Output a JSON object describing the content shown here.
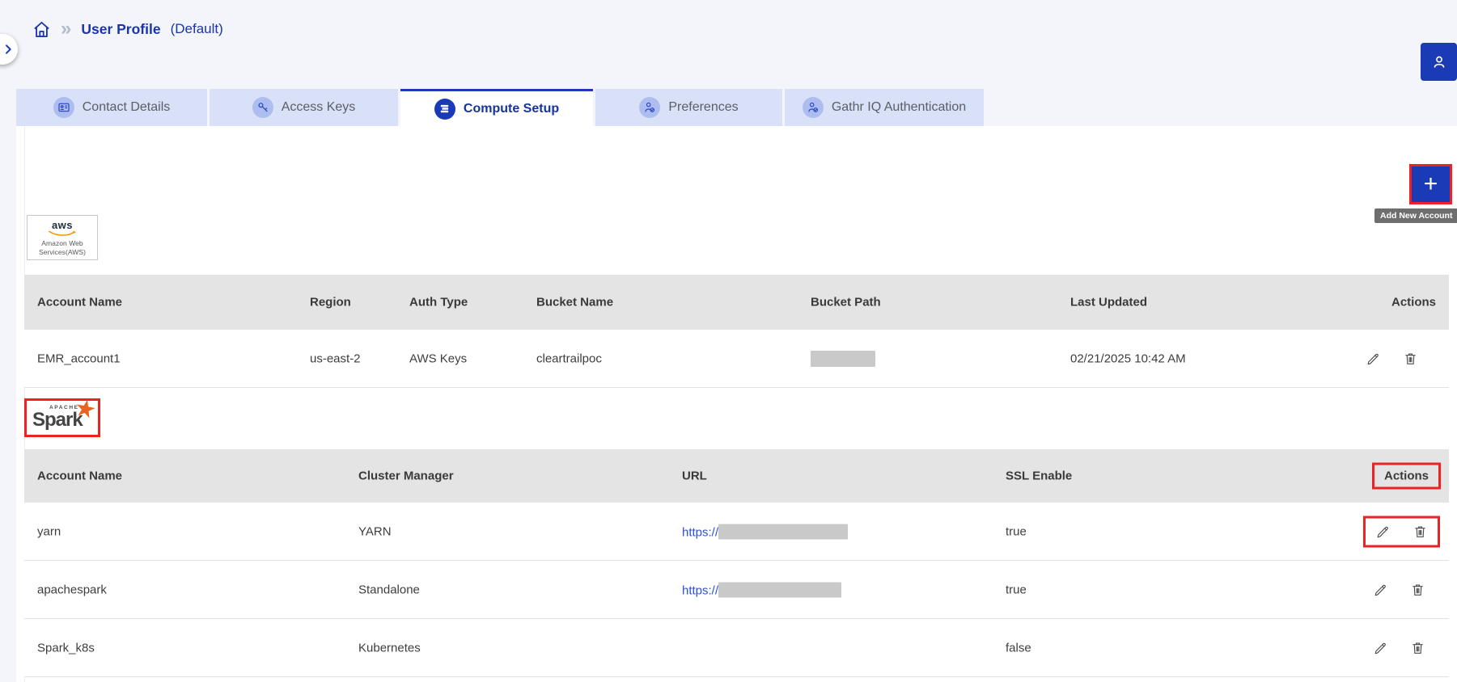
{
  "breadcrumb": {
    "separator": "»",
    "page_title": "User Profile",
    "page_subtitle": "(Default)"
  },
  "tabs": [
    {
      "label": "Contact Details",
      "icon": "contact-card-icon",
      "active": false
    },
    {
      "label": "Access Keys",
      "icon": "key-icon",
      "active": false
    },
    {
      "label": "Compute Setup",
      "icon": "compute-icon",
      "active": true
    },
    {
      "label": "Preferences",
      "icon": "person-check-icon",
      "active": false
    },
    {
      "label": "Gathr IQ Authentication",
      "icon": "person-check-icon",
      "active": false
    }
  ],
  "add_button": {
    "label": "+",
    "tooltip": "Add New Account"
  },
  "aws_section": {
    "logo_title": "aws",
    "logo_caption": "Amazon Web Services(AWS)",
    "columns": [
      "Account Name",
      "Region",
      "Auth Type",
      "Bucket Name",
      "Bucket Path",
      "Last Updated",
      "Actions"
    ],
    "rows": [
      {
        "account_name": "EMR_account1",
        "region": "us-east-2",
        "auth_type": "AWS Keys",
        "bucket_name": "cleartrailpoc",
        "bucket_path_redacted": true,
        "last_updated": "02/21/2025 10:42 AM"
      }
    ]
  },
  "spark_section": {
    "logo_title": "Spark",
    "logo_caption": "APACHE",
    "columns": [
      "Account Name",
      "Cluster Manager",
      "URL",
      "SSL Enable",
      "Actions"
    ],
    "rows": [
      {
        "account_name": "yarn",
        "cluster_manager": "YARN",
        "url_prefix": "https://",
        "url_redacted": true,
        "ssl_enable": "true",
        "actions_highlighted": true
      },
      {
        "account_name": "apachespark",
        "cluster_manager": "Standalone",
        "url_prefix": "https://",
        "url_redacted": true,
        "ssl_enable": "true",
        "actions_highlighted": false
      },
      {
        "account_name": "Spark_k8s",
        "cluster_manager": "Kubernetes",
        "url_prefix": "",
        "url_redacted": false,
        "ssl_enable": "false",
        "actions_highlighted": false
      }
    ]
  },
  "colors": {
    "accent_blue": "#1b3ab5",
    "annotation_red": "#ed2224",
    "link_blue": "#2b50d6",
    "table_header_gray": "#e4e4e4",
    "tooltip_gray": "#6e6e6e",
    "redaction_gray": "#c9c9c9",
    "aws_orange": "#f79400",
    "spark_orange": "#e8641f",
    "page_background": "#f3f5fb"
  }
}
